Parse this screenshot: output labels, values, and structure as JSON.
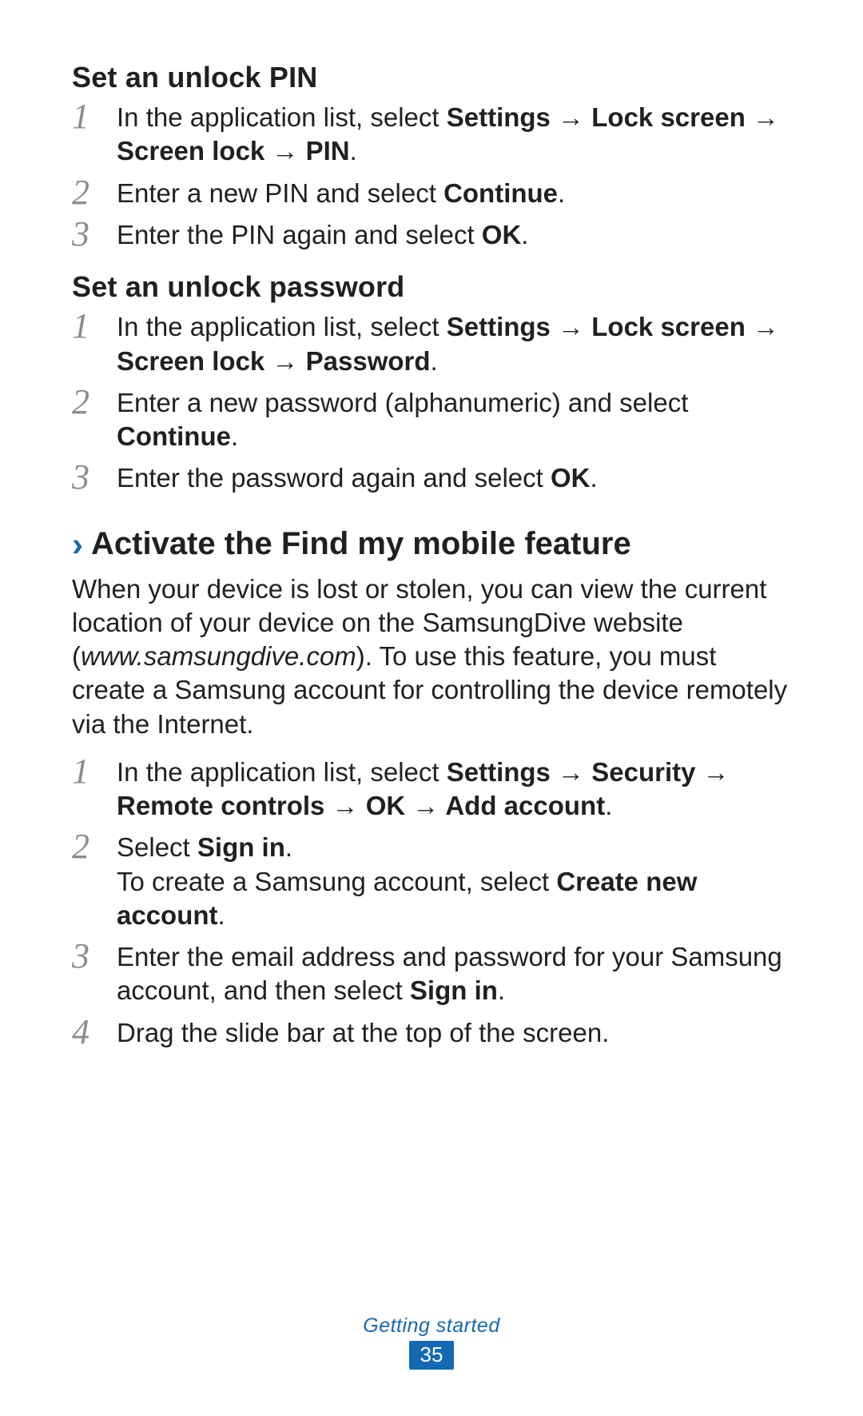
{
  "arrow": "→",
  "pin": {
    "heading": "Set an unlock PIN",
    "s1a": "In the application list, select ",
    "s1b": "Settings",
    "s1c": "Lock screen",
    "s1d": "Screen lock",
    "s1e": "PIN",
    "s1f": ".",
    "s2a": "Enter a new PIN and select ",
    "s2b": "Continue",
    "s2c": ".",
    "s3a": "Enter the PIN again and select ",
    "s3b": "OK",
    "s3c": "."
  },
  "pwd": {
    "heading": "Set an unlock password",
    "s1a": "In the application list, select ",
    "s1b": "Settings",
    "s1c": "Lock screen",
    "s1d": "Screen lock",
    "s1e": "Password",
    "s1f": ".",
    "s2a": "Enter a new password (alphanumeric) and select ",
    "s2b": "Continue",
    "s2c": ".",
    "s3a": "Enter the password again and select ",
    "s3b": "OK",
    "s3c": "."
  },
  "find": {
    "chev": "›",
    "heading": "Activate the Find my mobile feature",
    "p1": "When your device is lost or stolen, you can view the current location of your device on the SamsungDive website (",
    "url": "www.samsungdive.com",
    "p2": "). To use this feature, you must create a Samsung account for controlling the device remotely via the Internet.",
    "s1a": "In the application list, select ",
    "s1b": "Settings",
    "s1c": "Security",
    "s1d": "Remote controls",
    "s1e": "OK",
    "s1f": "Add account",
    "s1g": ".",
    "s2a": "Select ",
    "s2b": "Sign in",
    "s2c": ".",
    "s2d": "To create a Samsung account, select ",
    "s2e": "Create new account",
    "s2f": ".",
    "s3a": "Enter the email address and password for your Samsung account, and then select ",
    "s3b": "Sign in",
    "s3c": ".",
    "s4a": "Drag the slide bar at the top of the screen."
  },
  "nums": {
    "1": "1",
    "2": "2",
    "3": "3",
    "4": "4"
  },
  "footer": {
    "label": "Getting started",
    "page": "35"
  }
}
